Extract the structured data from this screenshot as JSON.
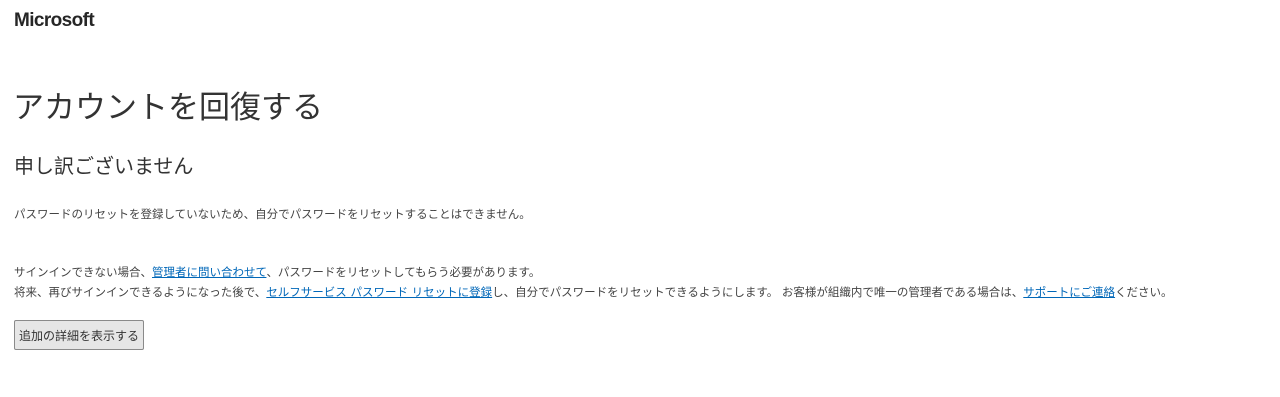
{
  "header": {
    "logo_text": "Microsoft"
  },
  "main": {
    "title": "アカウントを回復する",
    "subtitle": "申し訳ございません",
    "message_reset_not_registered": "パスワードのリセットを登録していないため、自分でパスワードをリセットすることはできません。",
    "line2": {
      "prefix": "サインインできない場合、",
      "contact_admin_link": "管理者に問い合わせて",
      "suffix": "、パスワードをリセットしてもらう必要があります。"
    },
    "line3": {
      "prefix": "将来、再びサインインできるようになった後で、",
      "register_link": "セルフサービス パスワード リセットに登録",
      "middle": "し、自分でパスワードをリセットできるようにします。 お客様が組織内で唯一の管理者である場合は、",
      "support_link": "サポートにご連絡",
      "suffix": "ください。"
    },
    "details_button_label": "追加の詳細を表示する"
  },
  "colors": {
    "link": "#0067b8",
    "text": "#333333",
    "button_bg": "#e6e6e6"
  }
}
